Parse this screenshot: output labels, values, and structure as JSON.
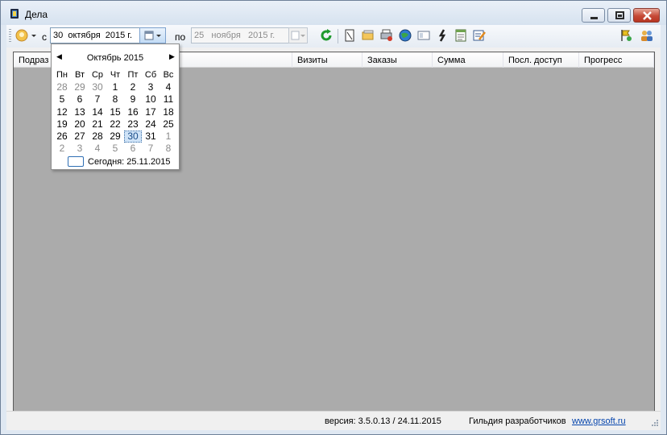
{
  "window": {
    "title": "Дела"
  },
  "toolbar": {
    "from_label": "с",
    "to_label": "по",
    "date_from": "30  октября  2015 г.",
    "date_to": "25   ноября   2015 г.",
    "icons": [
      "user-avatar-icon",
      "refresh-icon",
      "document-icon",
      "folder-stack-icon",
      "printer-icon",
      "globe-icon",
      "link-chain-icon",
      "card-icon",
      "list-icon",
      "notes-edit-icon",
      "flag-user-icon",
      "group-icon"
    ]
  },
  "grid": {
    "columns": [
      "Подраз",
      "Визиты",
      "Заказы",
      "Сумма",
      "Посл. доступ",
      "Прогресс"
    ]
  },
  "calendar": {
    "month_title": "Октябрь 2015",
    "weekdays": [
      "Пн",
      "Вт",
      "Ср",
      "Чт",
      "Пт",
      "Сб",
      "Вс"
    ],
    "weeks": [
      [
        "28",
        "29",
        "30",
        "1",
        "2",
        "3",
        "4"
      ],
      [
        "5",
        "6",
        "7",
        "8",
        "9",
        "10",
        "11"
      ],
      [
        "12",
        "13",
        "14",
        "15",
        "16",
        "17",
        "18"
      ],
      [
        "19",
        "20",
        "21",
        "22",
        "23",
        "24",
        "25"
      ],
      [
        "26",
        "27",
        "28",
        "29",
        "30",
        "31",
        "1"
      ],
      [
        "2",
        "3",
        "4",
        "5",
        "6",
        "7",
        "8"
      ]
    ],
    "selected_day": "30",
    "today_label": "Сегодня: 25.11.2015"
  },
  "status": {
    "version": "версия: 3.5.0.13 / 24.11.2015",
    "guild": "Гильдия разработчиков",
    "link": "www.grsoft.ru"
  },
  "colors": {
    "grid_background": "#ababab",
    "selected_day_bg": "#cfe3f7",
    "link": "#0645ad"
  }
}
